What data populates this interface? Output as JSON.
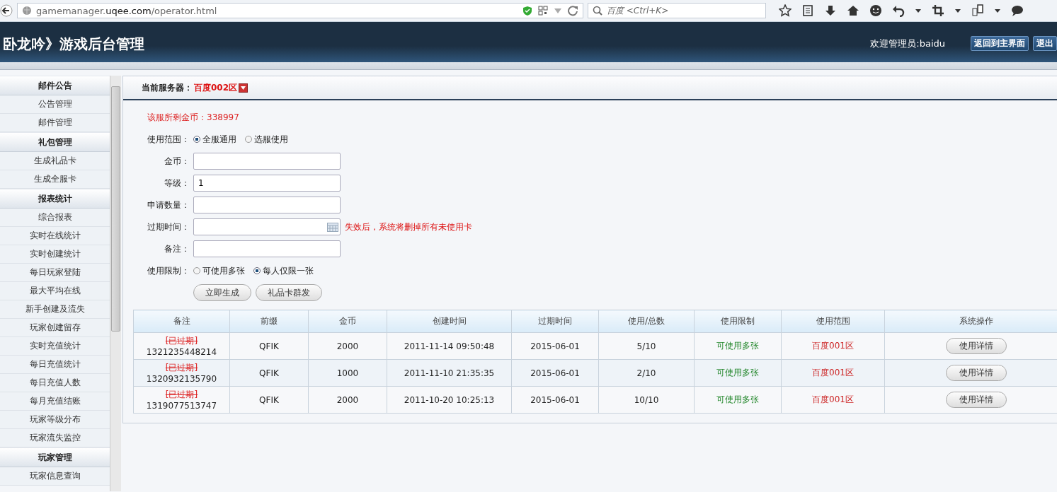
{
  "browser": {
    "url": "gamemanager.**uqee.com**/operator.html",
    "search_placeholder": "百度 <Ctrl+K>"
  },
  "header": {
    "title": "卧龙吟》游戏后台管理",
    "welcome": "欢迎管理员:baidu",
    "buttons": [
      "返回到主界面",
      "退出"
    ]
  },
  "sidebar": {
    "groups": [
      {
        "title": "邮件公告",
        "items": [
          "公告管理",
          "邮件管理"
        ]
      },
      {
        "title": "礼包管理",
        "items": [
          "生成礼品卡",
          "生成全服卡"
        ]
      },
      {
        "title": "报表统计",
        "items": [
          "综合报表",
          "实时在线统计",
          "实时创建统计",
          "每日玩家登陆",
          "最大平均在线",
          "新手创建及流失",
          "玩家创建留存",
          "实时充值统计",
          "每日充值统计",
          "每日充值人数",
          "每月充值结账",
          "玩家等级分布",
          "玩家流失监控"
        ]
      },
      {
        "title": "玩家管理",
        "items": [
          "玩家信息查询"
        ]
      }
    ]
  },
  "server": {
    "label": "当前服务器：",
    "value": "百度002区"
  },
  "gold_notice": "该服所剩金币：338997",
  "form": {
    "fields": [
      {
        "kind": "radio",
        "label": "使用范围：",
        "options": [
          {
            "label": "全服通用",
            "selected": true
          },
          {
            "label": "选服使用",
            "selected": false
          }
        ]
      },
      {
        "kind": "text",
        "label": "金币："
      },
      {
        "kind": "text",
        "label": "等级：",
        "value": "1"
      },
      {
        "kind": "text",
        "label": "申请数量："
      },
      {
        "kind": "date",
        "label": "过期时间：",
        "hint": "失效后，系统将删掉所有未使用卡"
      },
      {
        "kind": "text",
        "label": "备注："
      },
      {
        "kind": "radio",
        "label": "使用限制：",
        "options": [
          {
            "label": "可使用多张",
            "selected": false
          },
          {
            "label": "每人仅限一张",
            "selected": true
          }
        ]
      }
    ],
    "buttons": [
      "立即生成",
      "礼品卡群发"
    ]
  },
  "table": {
    "columns": [
      "备注",
      "前缀",
      "金币",
      "创建时间",
      "过期时间",
      "使用/总数",
      "使用限制",
      "使用范围",
      "系统操作"
    ],
    "rows": [
      {
        "status": "[已过期]",
        "id": "1321235448214",
        "prefix": "QFIK",
        "gold": "2000",
        "created": "2011-11-14 09:50:48",
        "expires": "2015-06-01",
        "usage": "5/10",
        "limit": "可使用多张",
        "scope": "百度001区",
        "action": "使用详情"
      },
      {
        "status": "[已过期]",
        "id": "1320932135790",
        "prefix": "QFIK",
        "gold": "1000",
        "created": "2011-11-10 21:35:35",
        "expires": "2015-06-01",
        "usage": "2/10",
        "limit": "可使用多张",
        "scope": "百度001区",
        "action": "使用详情"
      },
      {
        "status": "[已过期]",
        "id": "1319077513747",
        "prefix": "QFIK",
        "gold": "2000",
        "created": "2011-10-20 10:25:13",
        "expires": "2015-06-01",
        "usage": "10/10",
        "limit": "可使用多张",
        "scope": "百度001区",
        "action": "使用详情"
      }
    ]
  }
}
